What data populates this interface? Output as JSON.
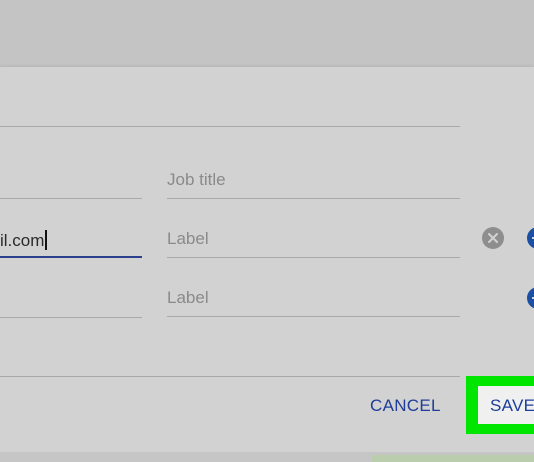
{
  "form": {
    "job_title_placeholder": "Job title",
    "email_value": "il.com",
    "email_label_placeholder": "Label",
    "phone_label_placeholder": "Label"
  },
  "icons": {
    "clear": "clear-circle-icon",
    "add": "add-circle-icon"
  },
  "actions": {
    "cancel_label": "CANCEL",
    "save_label": "SAVE"
  },
  "colors": {
    "accent": "#1f3d98",
    "highlight": "#00e600",
    "focus_underline": "#2b3f8c"
  }
}
